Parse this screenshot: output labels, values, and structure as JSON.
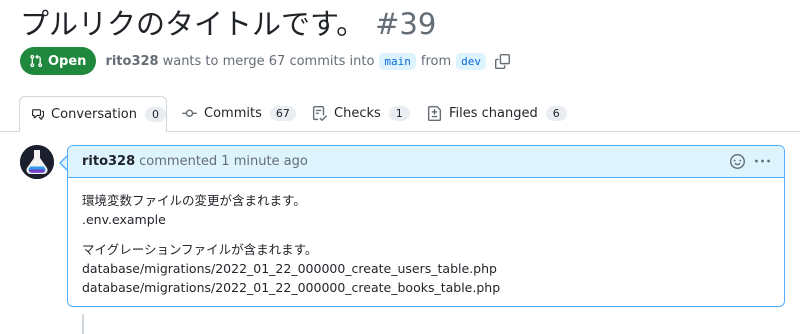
{
  "pr": {
    "title": "プルリクのタイトルです。",
    "number": "#39",
    "state": "Open",
    "author": "rito328",
    "merge_text": "wants to merge 67 commits into",
    "base_branch": "main",
    "from_text": "from",
    "head_branch": "dev"
  },
  "tabs": [
    {
      "label": "Conversation",
      "count": "0",
      "icon": "comment-discussion-icon",
      "active": true
    },
    {
      "label": "Commits",
      "count": "67",
      "icon": "git-commit-icon"
    },
    {
      "label": "Checks",
      "count": "1",
      "icon": "checklist-icon"
    },
    {
      "label": "Files changed",
      "count": "6",
      "icon": "file-diff-icon"
    }
  ],
  "comment": {
    "author": "rito328",
    "meta": "commented 1 minute ago",
    "paragraphs": [
      [
        "環境変数ファイルの変更が含まれます。",
        ".env.example"
      ],
      [
        "マイグレーションファイルが含まれます。",
        "database/migrations/2022_01_22_000000_create_users_table.php",
        "database/migrations/2022_01_22_000000_create_books_table.php"
      ]
    ]
  },
  "colors": {
    "open": "#1f883d",
    "accent": "#0969da",
    "header_bg": "#ddf4ff",
    "border": "#54aeff"
  }
}
